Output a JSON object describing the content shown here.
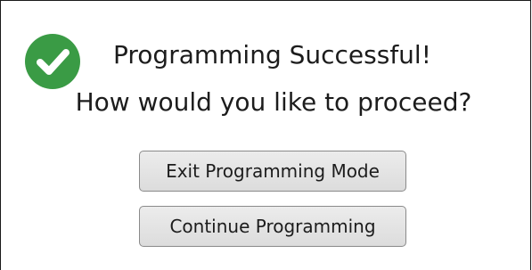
{
  "dialog": {
    "title": "Programming Successful!",
    "question": "How would you like to proceed?",
    "icon": "check-circle-icon",
    "icon_color": "#3a9b45",
    "buttons": {
      "exit_label": "Exit Programming Mode",
      "continue_label": "Continue Programming"
    }
  }
}
